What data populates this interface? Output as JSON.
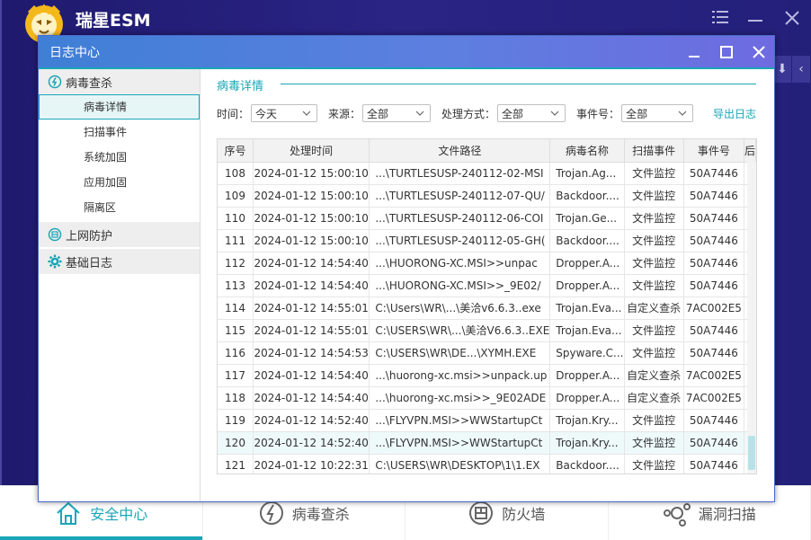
{
  "app": {
    "title": "瑞星ESM"
  },
  "bottom_tabs": [
    {
      "label": "安全中心",
      "icon": "home-icon",
      "active": true
    },
    {
      "label": "病毒查杀",
      "icon": "virus-scan-icon",
      "active": false
    },
    {
      "label": "防火墙",
      "icon": "firewall-icon",
      "active": false
    },
    {
      "label": "漏洞扫描",
      "icon": "vulnerability-scan-icon",
      "active": false
    }
  ],
  "dialog": {
    "title": "日志中心"
  },
  "sidebar": {
    "groups": [
      {
        "label": "病毒查杀",
        "icon": "virus-icon",
        "items": [
          "病毒详情",
          "扫描事件",
          "系统加固",
          "应用加固",
          "隔离区"
        ],
        "active_item": "病毒详情"
      },
      {
        "label": "上网防护",
        "icon": "web-protection-icon",
        "items": []
      },
      {
        "label": "基础日志",
        "icon": "gear-icon",
        "items": []
      }
    ]
  },
  "section": {
    "title": "病毒详情"
  },
  "filters": {
    "time_label": "时间：",
    "time_value": "今天",
    "source_label": "来源：",
    "source_value": "全部",
    "method_label": "处理方式：",
    "method_value": "全部",
    "event_label": "事件号：",
    "event_value": "全部",
    "export_label": "导出日志"
  },
  "table": {
    "columns": [
      "序号",
      "处理时间",
      "文件路径",
      "病毒名称",
      "扫描事件",
      "事件号",
      "后"
    ],
    "rows": [
      [
        "108",
        "2024-01-12 15:00:10",
        "...\\TURTLESUSP-240112-02-MSI",
        "Trojan.Ag...",
        "文件监控",
        "50A7446"
      ],
      [
        "109",
        "2024-01-12 15:00:10",
        "...\\TURTLESUSP-240112-07-QU/",
        "Backdoor....",
        "文件监控",
        "50A7446"
      ],
      [
        "110",
        "2024-01-12 15:00:10",
        "...\\TURTLESUSP-240112-06-COI",
        "Trojan.Ge...",
        "文件监控",
        "50A7446"
      ],
      [
        "111",
        "2024-01-12 15:00:10",
        "...\\TURTLESUSP-240112-05-GH(",
        "Backdoor....",
        "文件监控",
        "50A7446"
      ],
      [
        "112",
        "2024-01-12 14:54:40",
        "...\\HUORONG-XC.MSI>>unpac",
        "Dropper.A...",
        "文件监控",
        "50A7446"
      ],
      [
        "113",
        "2024-01-12 14:54:40",
        "...\\HUORONG-XC.MSI>>_9E02/",
        "Dropper.A...",
        "文件监控",
        "50A7446"
      ],
      [
        "114",
        "2024-01-12 14:55:01",
        "C:\\Users\\WR\\...\\美洽v6.6.3..exe",
        "Trojan.Eva...",
        "自定义查杀",
        "7AC002E5"
      ],
      [
        "115",
        "2024-01-12 14:55:01",
        "C:\\USERS\\WR\\...\\美洽V6.6.3..EXE",
        "Trojan.Eva...",
        "文件监控",
        "50A7446"
      ],
      [
        "116",
        "2024-01-12 14:54:53",
        "C:\\USERS\\WR\\DE...\\XYMH.EXE",
        "Spyware.C...",
        "文件监控",
        "50A7446"
      ],
      [
        "117",
        "2024-01-12 14:54:40",
        "...\\huorong-xc.msi>>unpack.up",
        "Dropper.A...",
        "自定义查杀",
        "7AC002E5"
      ],
      [
        "118",
        "2024-01-12 14:54:40",
        "...\\huorong-xc.msi>>_9E02ADE",
        "Dropper.A...",
        "自定义查杀",
        "7AC002E5"
      ],
      [
        "119",
        "2024-01-12 14:52:40",
        "...\\FLYVPN.MSI>>WWStartupCt",
        "Trojan.Kry...",
        "文件监控",
        "50A7446"
      ],
      [
        "120",
        "2024-01-12 14:52:40",
        "...\\FLYVPN.MSI>>WWStartupCt",
        "Trojan.Kry...",
        "文件监控",
        "50A7446"
      ],
      [
        "121",
        "2024-01-12 10:22:31",
        "C:\\USERS\\WR\\DESKTOP\\1\\1.EX",
        "Backdoor....",
        "文件监控",
        "50A7446"
      ]
    ],
    "highlighted_row": "120"
  },
  "colors": {
    "accent": "#1aa6b7",
    "titlebar": "#4f7fdc",
    "app_bg": "#25207c"
  }
}
